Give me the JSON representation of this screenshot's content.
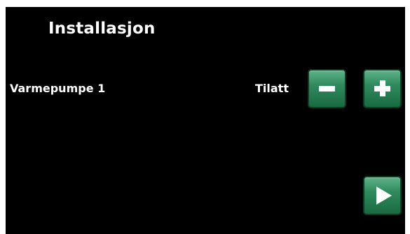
{
  "screen": {
    "title": "Installasjon"
  },
  "setting": {
    "label": "Varmepumpe 1",
    "value": "Tilatt"
  },
  "controls": {
    "decrease_icon": "minus-icon",
    "increase_icon": "plus-icon",
    "next_icon": "play-arrow-icon"
  },
  "colors": {
    "background": "#000000",
    "button_green": "#2f8a5d",
    "text": "#ffffff"
  }
}
